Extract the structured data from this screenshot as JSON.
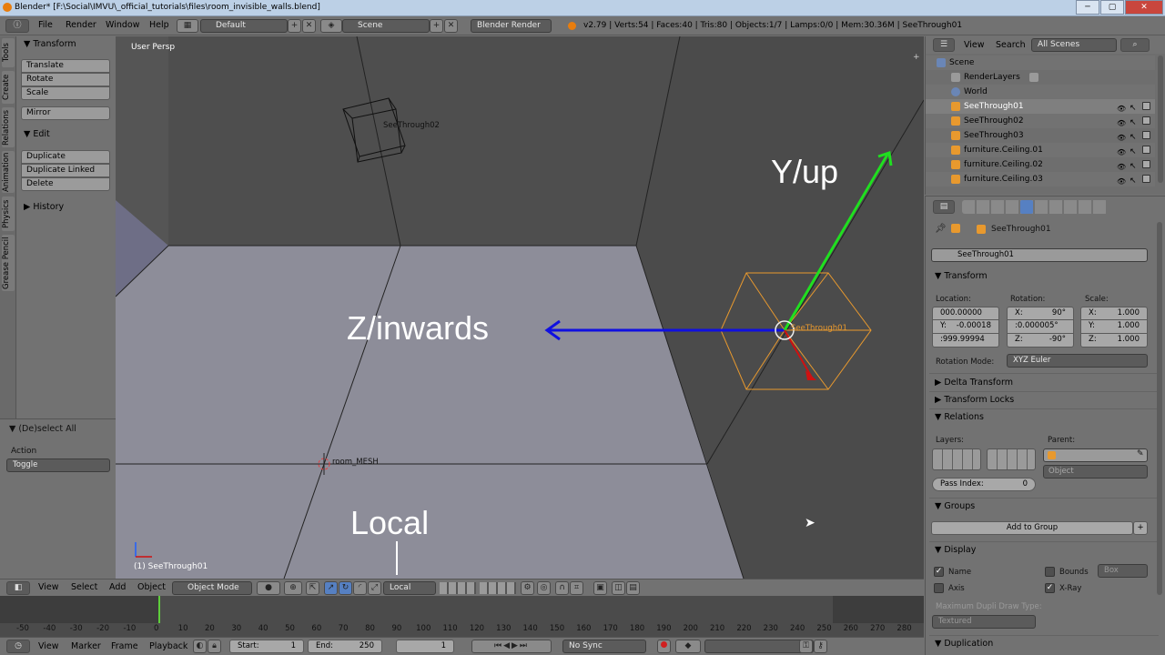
{
  "window": {
    "title": "Blender* [F:\\Social\\IMVU\\_official_tutorials\\files\\room_invisible_walls.blend]",
    "min": "─",
    "max": "▢",
    "close": "✕"
  },
  "infobar": {
    "menus": [
      "File",
      "Render",
      "Window",
      "Help"
    ],
    "layout": "Default",
    "scene": "Scene",
    "engine": "Blender Render",
    "stats": "v2.79 | Verts:54 | Faces:40 | Tris:80 | Objects:1/7 | Lamps:0/0 | Mem:30.36M | SeeThrough01"
  },
  "tabs": [
    "Tools",
    "Create",
    "Relations",
    "Animation",
    "Physics",
    "Grease Pencil"
  ],
  "toolshelf": {
    "transform_head": "Transform",
    "translate": "Translate",
    "rotate": "Rotate",
    "scale": "Scale",
    "mirror": "Mirror",
    "edit_head": "Edit",
    "duplicate": "Duplicate",
    "duplicate_linked": "Duplicate Linked",
    "delete": "Delete",
    "history_head": "History"
  },
  "redo": {
    "title": "(De)select All",
    "action_label": "Action",
    "action_value": "Toggle"
  },
  "viewport": {
    "persp": "User Persp",
    "active": "(1) SeeThrough01",
    "obj_seethrough02": "SeeThrough02",
    "obj_seethrough01": "SeeThrough01",
    "obj_room": "room_MESH",
    "anno_yup": "Y/up",
    "anno_zin": "Z/inwards",
    "anno_local": "Local"
  },
  "v3dheader": {
    "view": "View",
    "select": "Select",
    "add": "Add",
    "object": "Object",
    "mode": "Object Mode",
    "orientation": "Local"
  },
  "timeline": {
    "ticks": [
      "-50",
      "-40",
      "-30",
      "-20",
      "-10",
      "0",
      "10",
      "20",
      "30",
      "40",
      "50",
      "60",
      "70",
      "80",
      "90",
      "100",
      "110",
      "120",
      "130",
      "140",
      "150",
      "160",
      "170",
      "180",
      "190",
      "200",
      "210",
      "220",
      "230",
      "240",
      "250",
      "260",
      "270",
      "280"
    ],
    "view": "View",
    "marker": "Marker",
    "frame": "Frame",
    "playback": "Playback",
    "start_label": "Start:",
    "start": "1",
    "end_label": "End:",
    "end": "250",
    "current": "1",
    "sync": "No Sync"
  },
  "outliner": {
    "view": "View",
    "search": "Search",
    "filter": "All Scenes",
    "rows": [
      "Scene",
      "RenderLayers",
      "World",
      "SeeThrough01",
      "SeeThrough02",
      "SeeThrough03",
      "furniture.Ceiling.01",
      "furniture.Ceiling.02",
      "furniture.Ceiling.03"
    ]
  },
  "properties": {
    "breadcrumb": "SeeThrough01",
    "name": "SeeThrough01",
    "transform_head": "Transform",
    "location_label": "Location:",
    "rotation_label": "Rotation:",
    "scale_label": "Scale:",
    "loc_x": "000.00000",
    "loc_y_l": "Y:",
    "loc_y": "-0.00018",
    "loc_z": ":999.99994",
    "rot_x_l": "X:",
    "rot_x": "90°",
    "rot_y": ":0.000005°",
    "rot_z_l": "Z:",
    "rot_z": "-90°",
    "scl_x_l": "X:",
    "scl_x": "1.000",
    "scl_y_l": "Y:",
    "scl_y": "1.000",
    "scl_z_l": "Z:",
    "scl_z": "1.000",
    "rotation_mode_label": "Rotation Mode:",
    "rotation_mode": "XYZ Euler",
    "delta_head": "Delta Transform",
    "locks_head": "Transform Locks",
    "relations_head": "Relations",
    "layers_label": "Layers:",
    "parent_label": "Parent:",
    "parent_type": "Object",
    "pass_index_label": "Pass Index:",
    "pass_index": "0",
    "groups_head": "Groups",
    "add_to_group": "Add to Group",
    "display_head": "Display",
    "name_chk": "Name",
    "bounds_chk": "Bounds",
    "bounds_type": "Box",
    "axis_chk": "Axis",
    "xray_chk": "X-Ray",
    "max_dupli_label": "Maximum Dupli Draw Type:",
    "max_dupli": "Textured",
    "duplication_head": "Duplication"
  },
  "colors": {
    "y_axis": "#1fe01f",
    "z_axis": "#1010e0",
    "x_axis": "#d01010",
    "selection": "#e8992e"
  }
}
